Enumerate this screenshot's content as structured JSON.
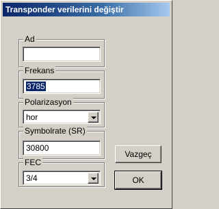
{
  "window": {
    "title": "Transponder verilerini değiştir"
  },
  "ad": {
    "label": "Ad",
    "value": ""
  },
  "frekans": {
    "label": "Frekans",
    "value": "3785"
  },
  "polarizasyon": {
    "label": "Polarizasyon",
    "selected": "hor"
  },
  "symbolrate": {
    "label": "Symbolrate (SR)",
    "value": "30800"
  },
  "fec": {
    "label": "FEC",
    "selected": "3/4"
  },
  "buttons": {
    "cancel_label": "Vazgeç",
    "ok_label": "OK"
  },
  "colors": {
    "titlebar_start": "#0a246a",
    "titlebar_end": "#a6caf0",
    "dialog_face": "#d4d0c8",
    "selection": "#0a246a"
  },
  "icons": {
    "combo_arrow": "chevron-down-icon"
  }
}
